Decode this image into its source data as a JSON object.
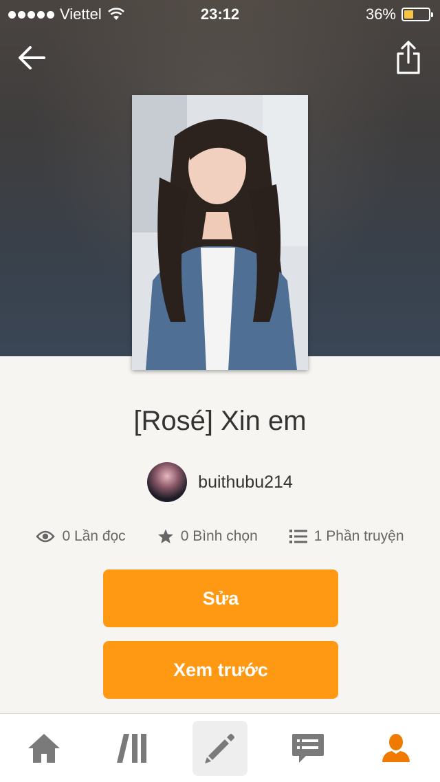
{
  "status_bar": {
    "carrier": "Viettel",
    "time": "23:12",
    "battery": "36%",
    "battery_level": 0.36
  },
  "header": {
    "back_icon": "arrow-left-icon",
    "share_icon": "share-icon"
  },
  "story": {
    "title": "[Rosé] Xin em",
    "author": "buithubu214",
    "stats": {
      "reads": "0 Lần đọc",
      "votes": "0 Bình chọn",
      "parts": "1 Phần truyện"
    }
  },
  "actions": {
    "edit_label": "Sửa",
    "preview_label": "Xem trước"
  },
  "tab_bar": {
    "items": [
      {
        "icon": "home-icon",
        "active": false
      },
      {
        "icon": "library-icon",
        "active": false
      },
      {
        "icon": "pencil-icon",
        "active": true
      },
      {
        "icon": "messages-icon",
        "active": false
      },
      {
        "icon": "profile-icon",
        "active": false
      }
    ]
  },
  "colors": {
    "accent": "#ff9914",
    "profile_active": "#f07a00",
    "battery_fill": "#f6c544"
  }
}
